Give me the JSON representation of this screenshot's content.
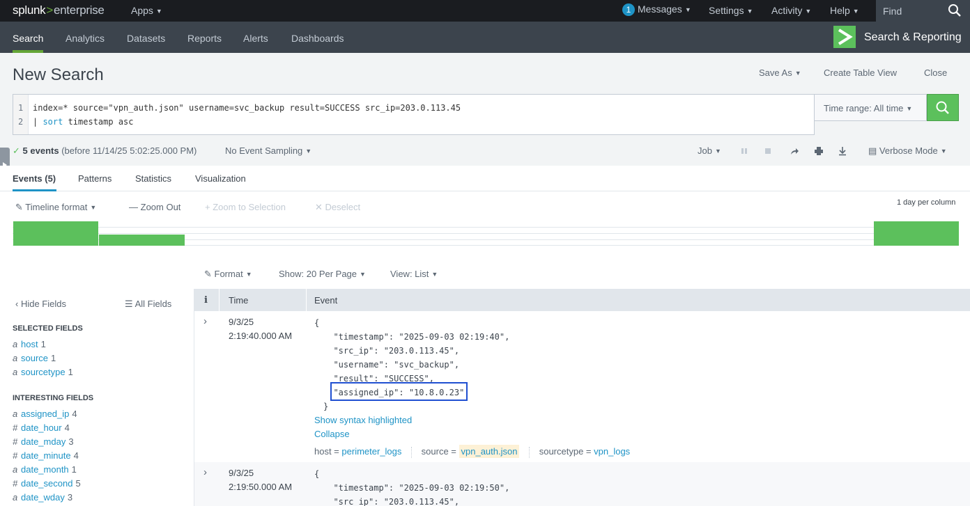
{
  "topbar": {
    "logo_brand": "splunk",
    "logo_sep": ">",
    "logo_product": "enterprise",
    "apps_label": "Apps",
    "messages_count": "1",
    "messages_label": "Messages",
    "settings_label": "Settings",
    "activity_label": "Activity",
    "help_label": "Help",
    "find_placeholder": "Find"
  },
  "appnav": {
    "items": [
      "Search",
      "Analytics",
      "Datasets",
      "Reports",
      "Alerts",
      "Dashboards"
    ],
    "active": "Search",
    "app_name": "Search & Reporting",
    "app_logo_glyph": ">"
  },
  "header": {
    "title": "New Search",
    "save_as": "Save As",
    "create_table_view": "Create Table View",
    "close": "Close"
  },
  "search": {
    "line_numbers": [
      "1",
      "2"
    ],
    "line1": "index=* source=\"vpn_auth.json\" username=svc_backup result=SUCCESS src_ip=203.0.113.45",
    "line2_pipe": "| ",
    "line2_cmd": "sort",
    "line2_rest": " timestamp asc",
    "time_range": "Time range: All time"
  },
  "status": {
    "count": "5 events",
    "detail": "(before 11/14/25 5:02:25.000 PM)",
    "sampling": "No Event Sampling",
    "job": "Job",
    "mode": "Verbose Mode"
  },
  "tabs": [
    "Events (5)",
    "Patterns",
    "Statistics",
    "Visualization"
  ],
  "timeline": {
    "format": "Timeline format",
    "zoom_out": "Zoom Out",
    "zoom_selection": "Zoom to Selection",
    "deselect": "Deselect",
    "scale": "1 day per column",
    "bars": [
      {
        "column": 0,
        "level": 1.0
      },
      {
        "column": 1,
        "level": 0.45
      },
      {
        "column": 10,
        "level": 1.0
      }
    ],
    "columns": 11,
    "color": "#5cc05c"
  },
  "list_controls": {
    "format": "Format",
    "per_page": "Show: 20 Per Page",
    "view": "View: List"
  },
  "fields": {
    "hide": "Hide Fields",
    "all": "All Fields",
    "selected_heading": "SELECTED FIELDS",
    "selected": [
      {
        "type": "a",
        "name": "host",
        "count": "1"
      },
      {
        "type": "a",
        "name": "source",
        "count": "1"
      },
      {
        "type": "a",
        "name": "sourcetype",
        "count": "1"
      }
    ],
    "interesting_heading": "INTERESTING FIELDS",
    "interesting": [
      {
        "type": "a",
        "name": "assigned_ip",
        "count": "4"
      },
      {
        "type": "#",
        "name": "date_hour",
        "count": "4"
      },
      {
        "type": "#",
        "name": "date_mday",
        "count": "3"
      },
      {
        "type": "#",
        "name": "date_minute",
        "count": "4"
      },
      {
        "type": "a",
        "name": "date_month",
        "count": "1"
      },
      {
        "type": "#",
        "name": "date_second",
        "count": "5"
      },
      {
        "type": "a",
        "name": "date_wday",
        "count": "3"
      }
    ]
  },
  "table": {
    "col_info": "i",
    "col_time": "Time",
    "col_event": "Event",
    "events": [
      {
        "date": "9/3/25",
        "time": "2:19:40.000 AM",
        "lines": [
          "{",
          "  \"timestamp\": \"2025-09-03 02:19:40\",",
          "  \"src_ip\": \"203.0.113.45\",",
          "  \"username\": \"svc_backup\",",
          "  \"result\": \"SUCCESS\",",
          "  \"assigned_ip\": \"10.8.0.23\"",
          "}"
        ],
        "show_syntax": "Show syntax highlighted",
        "collapse": "Collapse",
        "host_label": "host =",
        "host": "perimeter_logs",
        "source_label": "source =",
        "source": "vpn_auth.json",
        "sourcetype_label": "sourcetype =",
        "sourcetype": "vpn_logs"
      },
      {
        "date": "9/3/25",
        "time": "2:19:50.000 AM",
        "lines": [
          "{",
          "  \"timestamp\": \"2025-09-03 02:19:50\",",
          "  \"src_ip\": \"203.0.113.45\","
        ]
      }
    ]
  },
  "colors": {
    "topbar": "#1a1c20",
    "appbar": "#3c444d",
    "accent_green": "#5cc05c",
    "link_blue": "#1e93c6",
    "highlight_box": "#1f4fd1"
  }
}
